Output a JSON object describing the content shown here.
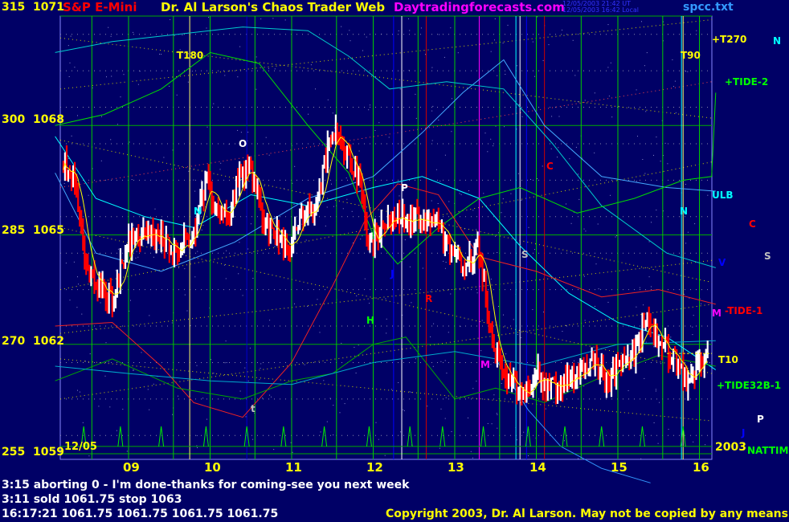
{
  "header": {
    "instrument": "S&P E-Mini",
    "title": "Dr. Al Larson's Chaos Trader Web",
    "site": "Daytradingforecasts.com",
    "stamp_line1": "12/05/2003 21:42 UT",
    "stamp_line2": "12/05/2003 16:42 Local",
    "file": "spcc.txt"
  },
  "y_labels": [
    {
      "left": "315",
      "price": "1071"
    },
    {
      "left": "300",
      "price": "1068"
    },
    {
      "left": "285",
      "price": "1065"
    },
    {
      "left": "270",
      "price": "1062"
    },
    {
      "left": "255",
      "price": "1059"
    }
  ],
  "date_label": "12/05",
  "year_label": "2003",
  "right_labels": [
    {
      "text": "+T270",
      "color": "#ffff00"
    },
    {
      "text": "N",
      "color": "#00ffff"
    },
    {
      "text": "+TIDE-2",
      "color": "#00ff00"
    },
    {
      "text": "ULB",
      "color": "#00ffff"
    },
    {
      "text": "C",
      "color": "#ff0000"
    },
    {
      "text": "V",
      "color": "#0000ff"
    },
    {
      "text": "S",
      "color": "#c0c0c0"
    },
    {
      "text": "M",
      "color": "#ff00ff"
    },
    {
      "text": "-TIDE-1",
      "color": "#ff0000"
    },
    {
      "text": "T10",
      "color": "#ffff00"
    },
    {
      "text": "+TIDE32B-1",
      "color": "#00ff00"
    },
    {
      "text": "P",
      "color": "#ffffff"
    },
    {
      "text": "J",
      "color": "#0000ff"
    },
    {
      "text": "NATTIME",
      "color": "#00ff00"
    }
  ],
  "chart_markers": [
    "T180",
    "T90",
    "O",
    "N",
    "N",
    "P",
    "C",
    "S",
    "H",
    "R",
    "M",
    "t",
    "J"
  ],
  "messages": [
    "3:15 aborting 0 - I'm done-thanks for coming-see you next week",
    "3:11 sold 1061.75 stop 1063",
    "16:17:21  1061.75 1061.75 1061.75 1061.75"
  ],
  "copyright": "Copyright 2003, Dr. Al Larson. May not be copied by any means.",
  "colors": {
    "background": "#000066",
    "plot_bg": "#000066",
    "up_bar": "#ffffff",
    "down_bar": "#ff0000",
    "hour_line": "#00cc00",
    "text": "#ffff00"
  },
  "chart_data": {
    "type": "bar",
    "x_label_hours": [
      "09",
      "10",
      "11",
      "12",
      "13",
      "14",
      "15",
      "16"
    ],
    "ylim": [
      1058.8,
      1071.3
    ],
    "y_ticks": [
      1071,
      1068,
      1065,
      1062,
      1059
    ],
    "price_path": [
      [
        8.2,
        1067.0
      ],
      [
        8.35,
        1066.6
      ],
      [
        8.45,
        1064.4
      ],
      [
        8.6,
        1063.6
      ],
      [
        8.8,
        1063.3
      ],
      [
        9.0,
        1064.8
      ],
      [
        9.2,
        1065.0
      ],
      [
        9.4,
        1064.9
      ],
      [
        9.6,
        1064.6
      ],
      [
        9.8,
        1065.1
      ],
      [
        9.95,
        1066.4
      ],
      [
        10.05,
        1065.8
      ],
      [
        10.2,
        1065.5
      ],
      [
        10.35,
        1066.6
      ],
      [
        10.5,
        1066.8
      ],
      [
        10.65,
        1065.4
      ],
      [
        10.85,
        1065.0
      ],
      [
        10.95,
        1064.4
      ],
      [
        11.1,
        1065.5
      ],
      [
        11.3,
        1065.8
      ],
      [
        11.45,
        1067.4
      ],
      [
        11.55,
        1067.9
      ],
      [
        11.7,
        1067.2
      ],
      [
        11.85,
        1066.2
      ],
      [
        11.95,
        1064.6
      ],
      [
        12.1,
        1065.3
      ],
      [
        12.3,
        1065.5
      ],
      [
        12.5,
        1065.4
      ],
      [
        12.7,
        1065.5
      ],
      [
        12.9,
        1064.8
      ],
      [
        13.1,
        1064.2
      ],
      [
        13.3,
        1064.6
      ],
      [
        13.45,
        1062.0
      ],
      [
        13.6,
        1061.2
      ],
      [
        13.8,
        1060.6
      ],
      [
        14.0,
        1061.2
      ],
      [
        14.2,
        1060.8
      ],
      [
        14.4,
        1061.0
      ],
      [
        14.55,
        1061.3
      ],
      [
        14.7,
        1061.6
      ],
      [
        14.85,
        1061.0
      ],
      [
        15.0,
        1061.4
      ],
      [
        15.2,
        1061.8
      ],
      [
        15.35,
        1062.6
      ],
      [
        15.5,
        1062.1
      ],
      [
        15.7,
        1061.6
      ],
      [
        15.85,
        1060.8
      ],
      [
        16.0,
        1061.5
      ],
      [
        16.1,
        1061.75
      ]
    ],
    "last_price": 1061.75
  }
}
